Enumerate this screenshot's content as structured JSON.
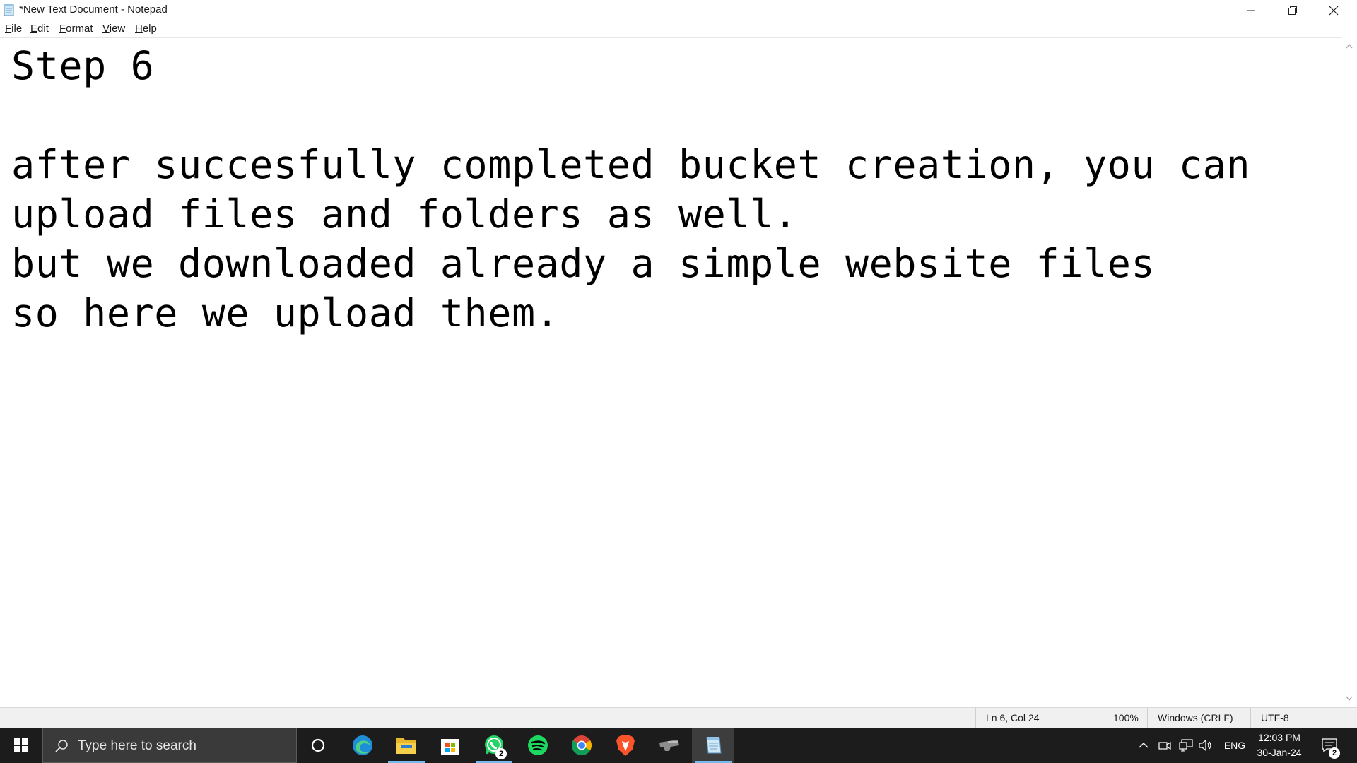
{
  "window": {
    "title": "*New Text Document - Notepad",
    "icon": "notepad-icon"
  },
  "menu": {
    "items": [
      {
        "label": "File"
      },
      {
        "label": "Edit"
      },
      {
        "label": "Format"
      },
      {
        "label": "View"
      },
      {
        "label": "Help"
      }
    ]
  },
  "editor": {
    "content": "Step 6\n\nafter succesfully completed bucket creation, you can\nupload files and folders as well.\nbut we downloaded already a simple website files\nso here we upload them."
  },
  "status": {
    "position": "Ln 6, Col 24",
    "zoom": "100%",
    "line_ending": "Windows (CRLF)",
    "encoding": "UTF-8"
  },
  "taskbar": {
    "search_placeholder": "Type here to search",
    "apps": [
      {
        "name": "cortana-icon"
      },
      {
        "name": "edge-icon"
      },
      {
        "name": "file-explorer-icon"
      },
      {
        "name": "microsoft-store-icon"
      },
      {
        "name": "whatsapp-icon",
        "badge": "2"
      },
      {
        "name": "spotify-icon"
      },
      {
        "name": "chrome-icon"
      },
      {
        "name": "brave-icon"
      },
      {
        "name": "app-icon"
      },
      {
        "name": "notepad-icon"
      }
    ],
    "tray": {
      "language": "ENG",
      "time": "12:03 PM",
      "date": "30-Jan-24",
      "notifications": "2"
    }
  },
  "colors": {
    "taskbar_bg": "#1c1c1c",
    "accent": "#76b9ed"
  }
}
